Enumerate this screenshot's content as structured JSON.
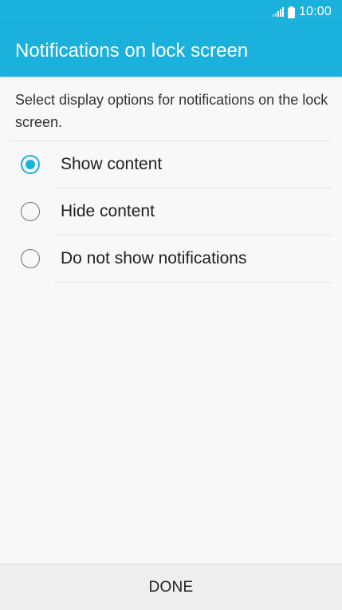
{
  "status_bar": {
    "time": "10:00",
    "signal_icon": "signal-icon",
    "battery_icon": "battery-icon"
  },
  "header": {
    "title": "Notifications on lock screen"
  },
  "content": {
    "description": "Select display options for notifications on the lock screen.",
    "options": [
      {
        "label": "Show content",
        "selected": true
      },
      {
        "label": "Hide content",
        "selected": false
      },
      {
        "label": "Do not show notifications",
        "selected": false
      }
    ]
  },
  "footer": {
    "done_label": "DONE"
  },
  "colors": {
    "accent": "#1ab1dd",
    "background": "#f8f8f8",
    "footer_background": "#eeeeee"
  }
}
